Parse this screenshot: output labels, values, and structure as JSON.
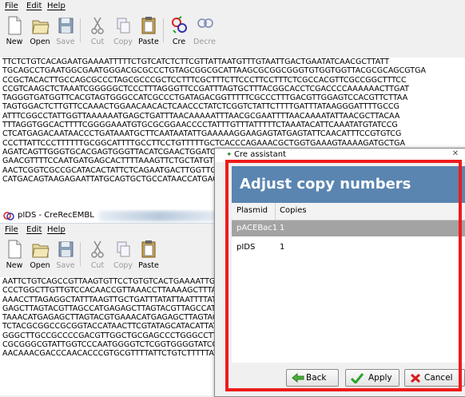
{
  "window1": {
    "menu": [
      "File",
      "Edit",
      "Help"
    ],
    "toolbar": [
      {
        "label": "New",
        "icon": "new-file-icon",
        "enabled": true
      },
      {
        "label": "Open",
        "icon": "open-folder-icon",
        "enabled": true
      },
      {
        "label": "Save",
        "icon": "save-disk-icon",
        "enabled": false
      },
      {
        "label": "Cut",
        "icon": "scissors-icon",
        "enabled": false
      },
      {
        "label": "Copy",
        "icon": "copy-icon",
        "enabled": false
      },
      {
        "label": "Paste",
        "icon": "clipboard-icon",
        "enabled": true
      },
      {
        "label": "Cre",
        "icon": "cre-recombine-icon",
        "enabled": true
      },
      {
        "label": "Decre",
        "icon": "decre-icon",
        "enabled": false
      }
    ],
    "sequence": [
      "TTCTCTGTCACAGAATGAAAATTTTTCTGTCATCTCTTCGTTATTAATGTTTGTAATTGACTGAATATCAACGCTTATT",
      "TGCAGCCTGAATGGCGAATGGGACGCGCCCTGTAGCGGCGCATTAAGCGCGGCGGGTGTGGTGGTTACGCGCAGCGTGA",
      "CCGCTACACTTGCCAGCGCCCTAGCGCCCGCTCCTTTCGCTTTCTTCCCTTCCTTTCTCGCCACGTTCGCCGGCTTTCC",
      "CCGTCAAGCTCTAAATCGGGGGCTCCCTTTAGGGTTCCGATTTAGTGCTTTACGGCACCTCGACCCCAAAAAACTTGAT",
      "TAGGGTGATGGTTCACGTAGTGGGCCATCGCCCTGATAGACGGTTTTTCGCCCTTTGACGTTGGAGTCCACGTTCTTAA",
      "TAGTGGACTCTTGTTCCAAACTGGAACAACACTCAACCCTATCTCGGTCTATTCTTTTGATTTATAAGGGATTTTGCCG",
      "ATTTCGGCCTATTGGTTAAAAAATGAGCTGATTTAACAAAAATTTAACGCGAATTTTAACAAAATATTAACGCTTACAA",
      "TTTAGGTGGCACTTTTCGGGGAAATGTGCGCGGAACCCCTATTTGTTTATTTTTCTAAATACATTCAAATATGTATCCG",
      "CTCATGAGACAATAACCCTGATAAATGCTTCAATAATATTGAAAAAGGAAGAGTATGAGTATTCAACATTTCCGTGTCG",
      "CCCTTATTCCCTTTTTTGCGGCATTTTGCCTTCCTGTTTTTGCTCACCCAGAAACGCTGGTGAAAGTAAAAGATGCTGA",
      "AGATCAGTTGGGTGCACGAGTGGGTTACATCGAACTGGATCTCAACAGCGGTAAGATCCTTGAGAGTTTTCGCCCCGAA",
      "GAACGTTTTCCAATGATGAGCACTTTTAAAGTTCTGCTATGTGGCGCGGTATTATCCCGTATTGACGCCGGGCAAGAGC",
      "AACTCGGTCGCCGCATACACTATTCTCAGAATGACTTGGTTGAGTACTCACCAGTCACAGAAAAGCATCTTACGGATGG",
      "CATGACAGTAAGAGAATTATGCAGTGCTGCCATAACCATGAGTGATAACACTGCGGCCAACTTACTTCTGACAACGATC"
    ]
  },
  "window2": {
    "title": "pIDS - CreRecEMBL",
    "menu": [
      "File",
      "Edit",
      "Help"
    ],
    "toolbar": [
      {
        "label": "New",
        "icon": "new-file-icon",
        "enabled": true
      },
      {
        "label": "Open",
        "icon": "open-folder-icon",
        "enabled": true
      },
      {
        "label": "Save",
        "icon": "save-disk-icon",
        "enabled": false
      },
      {
        "label": "Cut",
        "icon": "scissors-icon",
        "enabled": false
      },
      {
        "label": "Copy",
        "icon": "copy-icon",
        "enabled": false
      },
      {
        "label": "Paste",
        "icon": "clipboard-icon",
        "enabled": true
      }
    ],
    "sequence": [
      "AATTCTGTCAGCCGTTAAGTGTTCCTGTGTCACTGAAAATTGCTTTGAGAGGCTCTAAGGGCTTCTCAGTGCGTTACATC",
      "CCCTGGCTTGTTGTCCACAACCGTTAAACCTTAAAAGCTTTAAAAGCCTTATATATTCTTTTTTTTCTTATAAAACTTA",
      "AAACCTTAGAGGCTATTTAAGTTGCTGATTTATATTAATTTTATTGTTCAAACATGAGAGCTTAGTACGTGAAACATGA",
      "GAGCTTAGTACGTTAGCCATGAGAGCTTAGTACGTTAGCCATGAGGGTTTAGTTCGTTAAACATGAGAGCTTAGTACGT",
      "TAAACATGAGAGCTTAGTACGTGAAACATGAGAGCTTAGTACGTACTATCAACAGGTTGAACTGCTGATCTTCAGATCC",
      "TCTACGCGGCCGCGGTACCATAACTTCGTATAGCATACATTATACGAAGTTATGGATCCGCTAGCAGATCTGAGCTCGG",
      "GGGCTTGCCGCCCCGACGTTGGCTGCGAGCCCTGGGCCTTCACCCGAACTTGGGGGGTGGGGTGGGGAAAAGGAAGAAA",
      "CGCGGGCGTATTGGTCCCAATGGGGTCTCGGTGGGGTATCGACAGAGTGCCAGCCCTGGGACCGAACCCCGCGTTTATG",
      "AACAAACGACCCAACACCCGTGCGTTTTATTCTGTCTTTTTATTGCCGTCATAGCGCGGGTTCCTTCCGGTATTGTCTC"
    ]
  },
  "dialog": {
    "title": "Cre assistant",
    "heading": "Adjust copy numbers",
    "columns": [
      "Plasmid",
      "Copies"
    ],
    "rows": [
      {
        "plasmid": "pACEBac1",
        "copies": "1",
        "selected": true
      },
      {
        "plasmid": "pIDS",
        "copies": "1",
        "selected": false
      }
    ],
    "buttons": {
      "back": "Back",
      "apply": "Apply",
      "cancel": "Cancel"
    }
  },
  "colors": {
    "dialog_heading_bg": "#5a85b0",
    "highlight_frame": "#ee1b1b",
    "selected_row": "#a3a3a3"
  }
}
